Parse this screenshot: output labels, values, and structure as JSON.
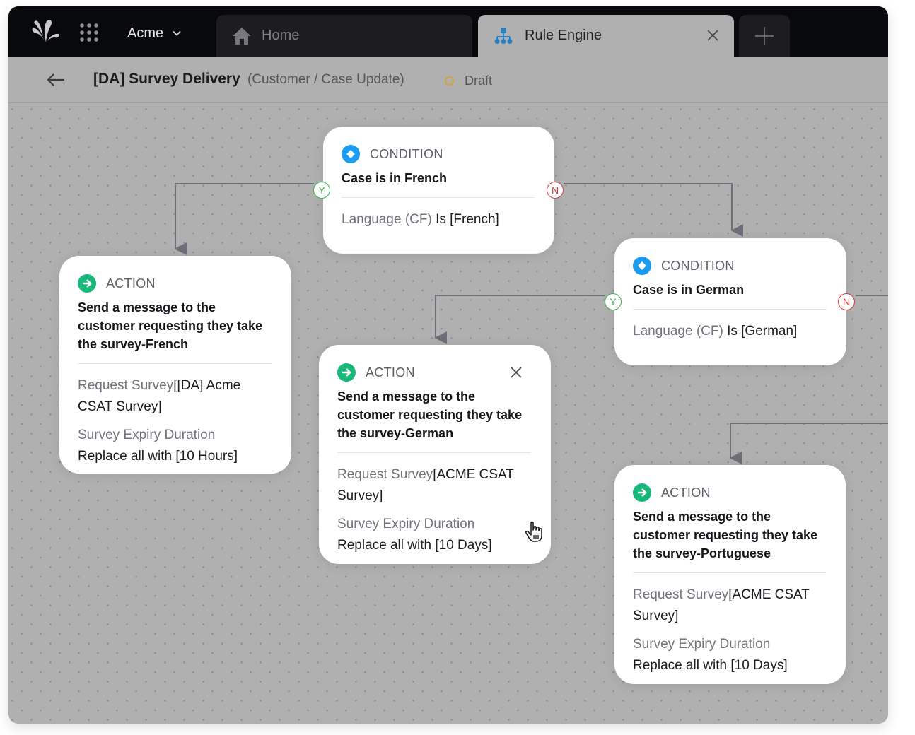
{
  "app": {
    "org_name": "Acme",
    "icons": {
      "logo": "brand-logo-icon",
      "apps": "grid-apps-icon",
      "org_dropdown": "chevron-down-icon"
    }
  },
  "tabs": [
    {
      "label": "Home",
      "icon": "home-icon",
      "active": false
    },
    {
      "label": "Rule Engine",
      "icon": "hierarchy-icon",
      "active": true,
      "closable": true
    },
    {
      "label": "",
      "icon": "plus-icon",
      "role": "new-tab"
    }
  ],
  "header": {
    "back_icon": "arrow-left-icon",
    "title": "[DA] Survey Delivery",
    "subtitle": "(Customer / Case Update)",
    "status": "Draft",
    "status_color": "#d4a23e"
  },
  "colors": {
    "condition_icon": "#1a9cf0",
    "action_icon": "#17b97b",
    "yes": "#35b04a",
    "no": "#dc3a3d",
    "connector": "#6d6e78"
  },
  "branch_labels": {
    "yes": "Y",
    "no": "N"
  },
  "nodes": {
    "condition_french": {
      "kind": "CONDITION",
      "title": "Case is in French",
      "field": "Language (CF)",
      "value": "Is [French]"
    },
    "action_french": {
      "kind": "ACTION",
      "title": "Send a message to the customer requesting they take the survey-French",
      "fields": [
        {
          "label": "Request Survey",
          "value": "[[DA] Acme CSAT Survey]"
        },
        {
          "label": "Survey Expiry Duration",
          "value": "Replace all with [10 Hours]"
        }
      ]
    },
    "condition_german": {
      "kind": "CONDITION",
      "title": "Case is in German",
      "field": "Language (CF)",
      "value": "Is [German]"
    },
    "action_german": {
      "kind": "ACTION",
      "title": "Send a message to the customer requesting they take the survey-German",
      "fields": [
        {
          "label": "Request Survey",
          "value": "[ACME CSAT Survey]"
        },
        {
          "label": "Survey Expiry Duration",
          "value": "Replace all with [10 Days]"
        }
      ]
    },
    "action_portuguese": {
      "kind": "ACTION",
      "title": "Send a message to the customer requesting they take the survey-Portuguese",
      "fields": [
        {
          "label": "Request Survey",
          "value": "[ACME CSAT Survey]"
        },
        {
          "label": "Survey Expiry Duration",
          "value": "Replace all with [10 Days]"
        }
      ]
    }
  }
}
